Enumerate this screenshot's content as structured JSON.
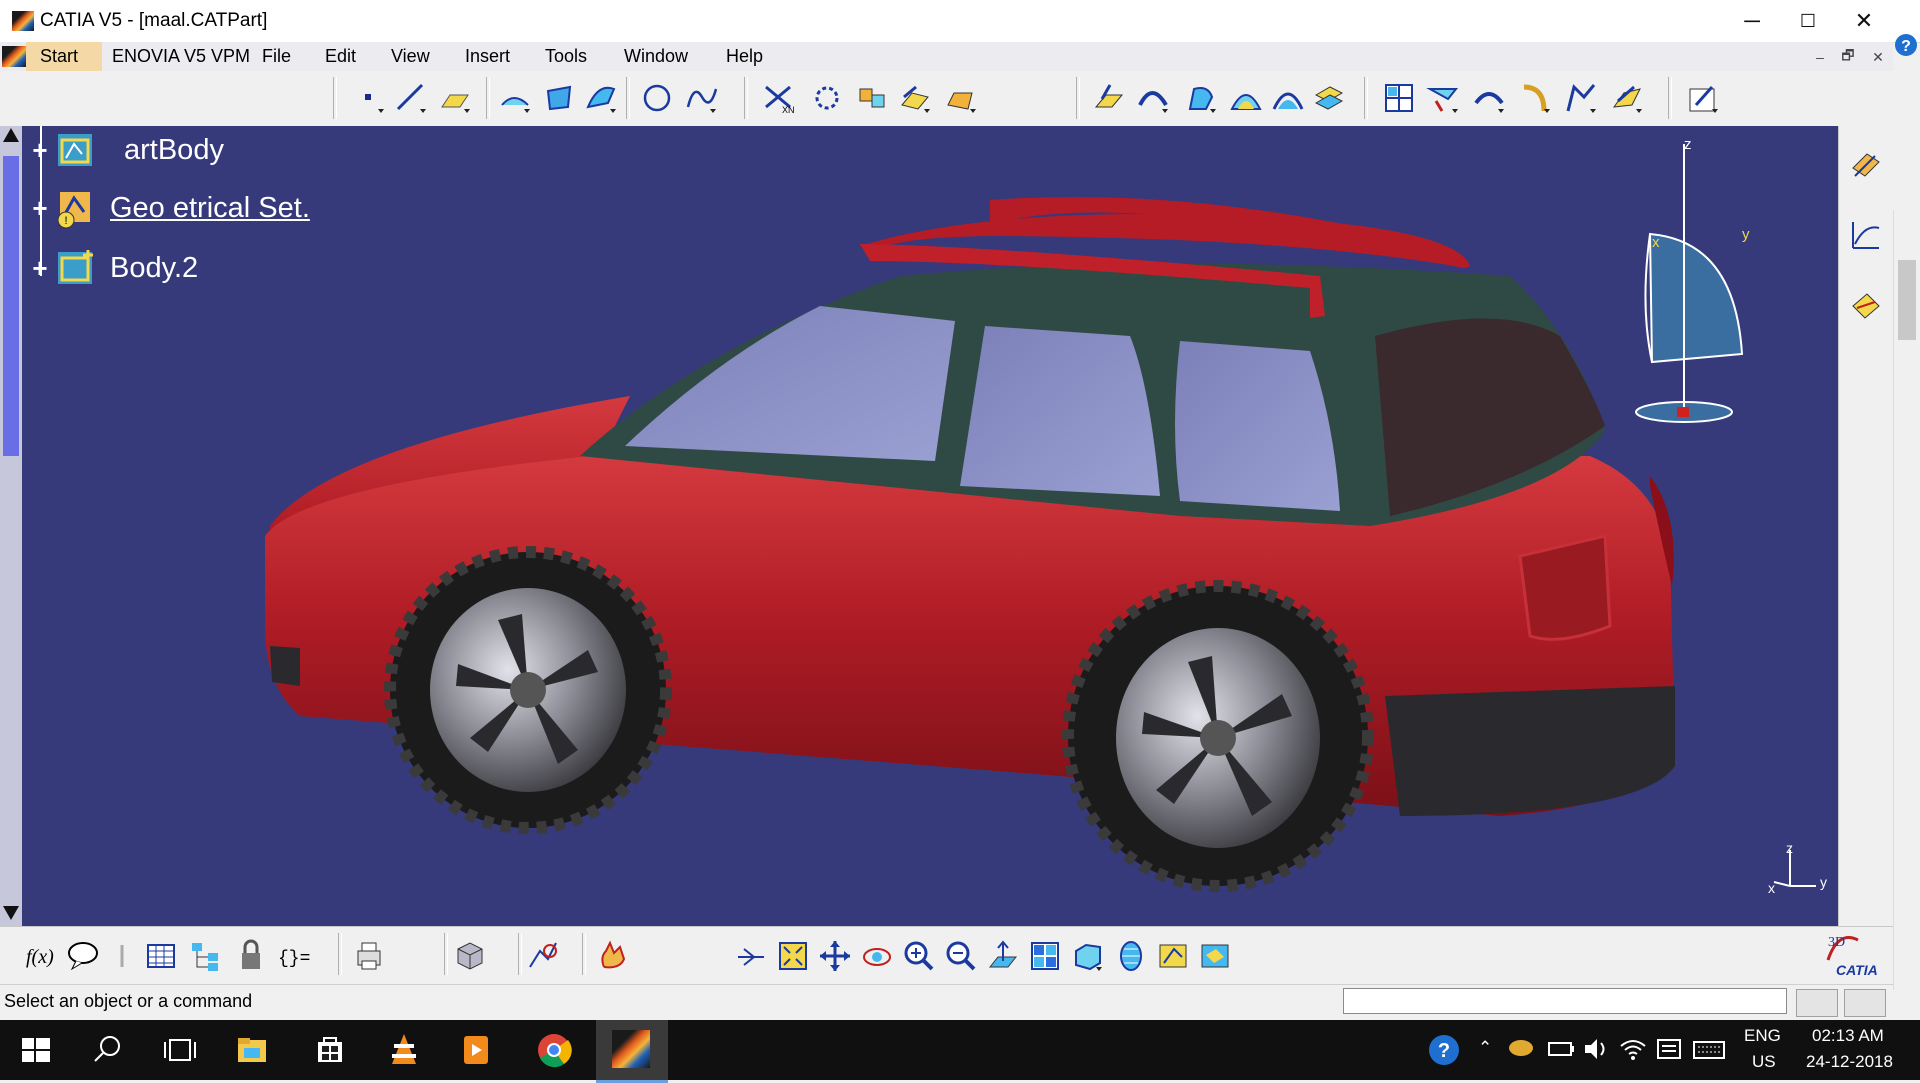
{
  "window": {
    "title": "CATIA V5 - [maal.CATPart]",
    "minimize_glyph": "─",
    "maximize_glyph": "☐",
    "close_glyph": "✕"
  },
  "menu": {
    "items": [
      "Start",
      "ENOVIA V5 VPM",
      "File",
      "Edit",
      "View",
      "Insert",
      "Tools",
      "Window",
      "Help"
    ],
    "mdi_min": "–",
    "mdi_restore": "🗗",
    "mdi_close": "✕"
  },
  "tree": {
    "items": [
      {
        "label": "artBody",
        "icon": "part-body-icon"
      },
      {
        "label": "Geo   etrical Set.",
        "icon": "geometrical-set-icon"
      },
      {
        "label": "Body.2",
        "icon": "body-icon"
      }
    ],
    "expand_glyph": "+"
  },
  "compass": {
    "x": "x",
    "y": "y",
    "z": "z"
  },
  "axis": {
    "x": "x",
    "y": "y",
    "z": "z"
  },
  "status": {
    "message": "Select an object or a command",
    "command_value": ""
  },
  "brand": {
    "text": "CATIA"
  },
  "taskbar": {
    "language": "ENG",
    "region": "US",
    "time": "02:13 AM",
    "date": "24-12-2018"
  },
  "colors": {
    "viewport": "#363a7a",
    "car_body": "#b01c25",
    "car_roof": "#2f4a45",
    "start_highlight": "#f4d9a6"
  }
}
